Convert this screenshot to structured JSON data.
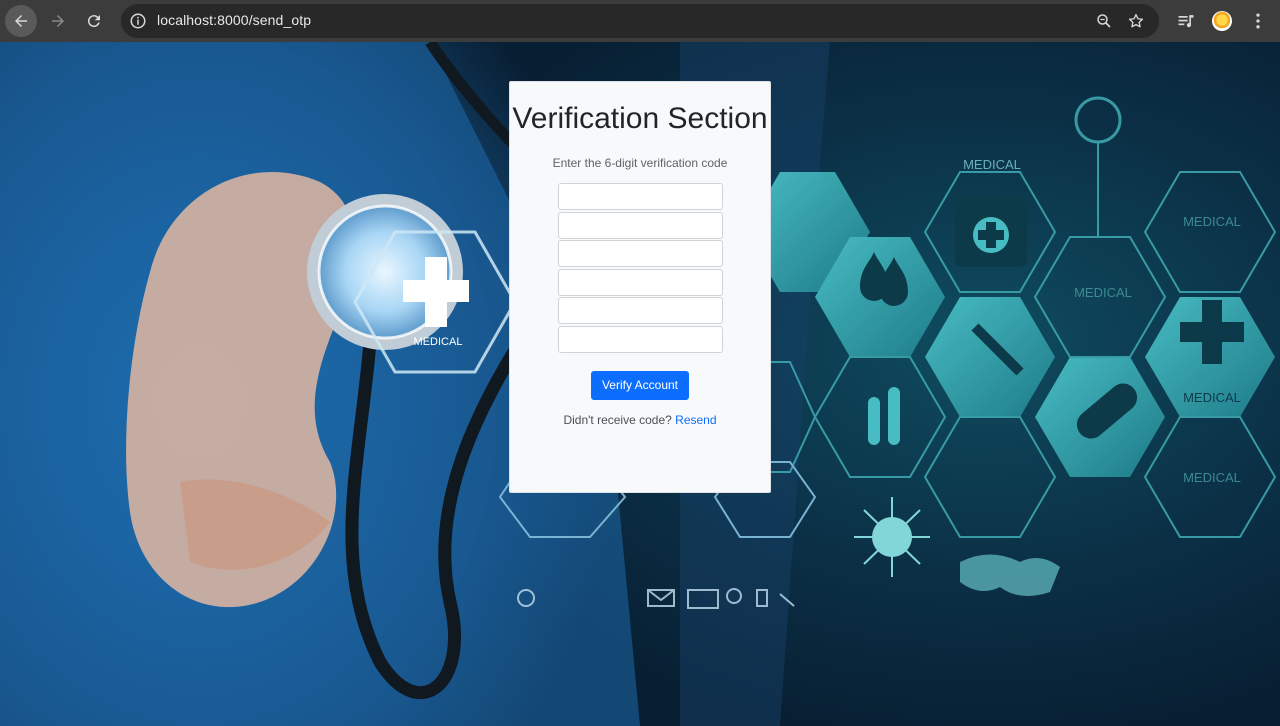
{
  "browser": {
    "url_host": "localhost",
    "url_rest": ":8000/send_otp",
    "icons": {
      "back": "arrow-left-icon",
      "forward": "arrow-right-icon",
      "reload": "reload-icon",
      "site_info": "info-icon",
      "zoom": "magnifier-icon",
      "bookmark": "star-icon",
      "media": "media-queue-icon",
      "profile": "avatar",
      "menu": "kebab-menu-icon"
    }
  },
  "card": {
    "title": "Verification Section",
    "subtitle": "Enter the 6-digit verification code",
    "otp_fields": [
      "",
      "",
      "",
      "",
      "",
      ""
    ],
    "verify_label": "Verify Account",
    "resend_prompt": "Didn't receive code?",
    "resend_link": "Resend"
  },
  "background": {
    "labels": [
      "MEDICAL",
      "MEDICAL",
      "MEDICAL",
      "MEDICAL",
      "MEDICAL",
      "MEDICAL"
    ]
  },
  "colors": {
    "primary": "#0d6efd",
    "card_bg": "#f8f9fa",
    "chrome": "#3c3c3c",
    "omnibox": "#282828"
  }
}
